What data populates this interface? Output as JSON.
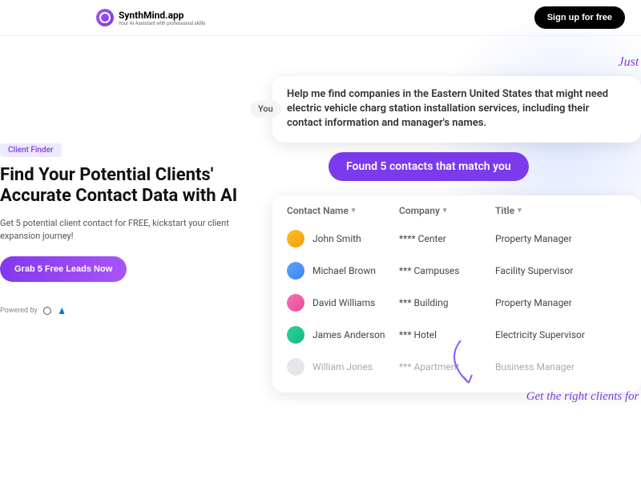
{
  "header": {
    "brand": "SynthMind.app",
    "tagline": "Your AI Assistant with professional skills",
    "signup": "Sign up for free"
  },
  "hero": {
    "badge": "Client Finder",
    "headline": "Find Your Potential Clients' Accurate Contact Data with AI",
    "subtext": "Get 5 potential client contact for FREE,\nkickstart your client expansion journey!",
    "cta": "Grab 5 Free Leads Now",
    "powered_label": "Powered by"
  },
  "demo": {
    "handwrite_top": "Just Ch",
    "you_label": "You",
    "user_message": "Help me find companies in the Eastern United States that might need electric vehicle charg station installation services, including their contact information and manager's names.",
    "found_message": "Found 5 contacts that match you",
    "columns": {
      "name": "Contact Name",
      "company": "Company",
      "title": "Title"
    },
    "rows": [
      {
        "name": "John Smith",
        "company": "**** Center",
        "title": "Property Manager"
      },
      {
        "name": "Michael Brown",
        "company": "*** Campuses",
        "title": "Facility Supervisor"
      },
      {
        "name": "David Williams",
        "company": "*** Building",
        "title": "Property Manager"
      },
      {
        "name": "James Anderson",
        "company": "*** Hotel",
        "title": "Electricity Supervisor"
      },
      {
        "name": "William Jones",
        "company": "*** Apartment",
        "title": "Business Manager"
      }
    ],
    "handwrite_bottom": "Get the right clients for your b"
  }
}
